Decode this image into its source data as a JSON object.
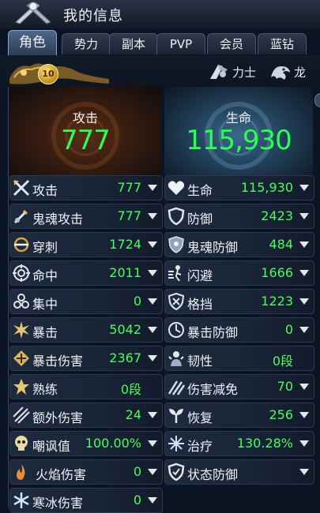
{
  "window": {
    "title": "我的信息"
  },
  "tabs": [
    {
      "label": "角色",
      "active": true
    },
    {
      "label": "势力",
      "active": false
    },
    {
      "label": "副本",
      "active": false
    },
    {
      "label": "PVP",
      "active": false
    },
    {
      "label": "会员",
      "active": false
    },
    {
      "label": "蓝钻",
      "active": false
    }
  ],
  "character": {
    "level": "10",
    "class_label": "力士",
    "class_icon": "strongman-icon",
    "race_label": "龙",
    "race_icon": "dragon-icon"
  },
  "summary": {
    "attack": {
      "label": "攻击",
      "value": "777"
    },
    "life": {
      "label": "生命",
      "value": "115,930"
    }
  },
  "stats_left": [
    {
      "label": "攻击",
      "value": "777",
      "icon": "crossed-swords-icon"
    },
    {
      "label": "鬼魂攻击",
      "value": "777",
      "icon": "ghost-sword-icon"
    },
    {
      "label": "穿刺",
      "value": "1724",
      "icon": "pierce-icon"
    },
    {
      "label": "命中",
      "value": "2011",
      "icon": "target-icon"
    },
    {
      "label": "集中",
      "value": "0",
      "icon": "focus-icon"
    },
    {
      "label": "暴击",
      "value": "5042",
      "icon": "burst-icon"
    },
    {
      "label": "暴击伤害",
      "value": "2367",
      "icon": "crit-damage-icon"
    },
    {
      "label": "熟练",
      "value": "0段",
      "icon": "star-icon"
    },
    {
      "label": "额外伤害",
      "value": "24",
      "icon": "extra-damage-icon"
    },
    {
      "label": "嘲讽值",
      "value": "100.00%",
      "icon": "skull-icon"
    },
    {
      "label": "火焰伤害",
      "value": "0",
      "icon": "flame-icon"
    },
    {
      "label": "寒冰伤害",
      "value": "0",
      "icon": "ice-icon"
    }
  ],
  "stats_right": [
    {
      "label": "生命",
      "value": "115,930",
      "icon": "heart-icon"
    },
    {
      "label": "防御",
      "value": "2423",
      "icon": "shield-icon"
    },
    {
      "label": "鬼魂防御",
      "value": "484",
      "icon": "ghost-shield-icon"
    },
    {
      "label": "闪避",
      "value": "1666",
      "icon": "dodge-icon"
    },
    {
      "label": "格挡",
      "value": "1223",
      "icon": "block-icon"
    },
    {
      "label": "暴击防御",
      "value": "0",
      "icon": "crit-defense-icon"
    },
    {
      "label": "韧性",
      "value": "0段",
      "icon": "toughness-icon"
    },
    {
      "label": "伤害减免",
      "value": "70",
      "icon": "damage-reduction-icon"
    },
    {
      "label": "恢复",
      "value": "256",
      "icon": "recovery-icon"
    },
    {
      "label": "治疗",
      "value": "130.28%",
      "icon": "heal-icon"
    },
    {
      "label": "状态防御",
      "value": "",
      "icon": "status-defense-icon"
    }
  ],
  "colors": {
    "value_green": "#46ff5c",
    "big_value_green": "#2aff52",
    "background": "#0b1422"
  }
}
